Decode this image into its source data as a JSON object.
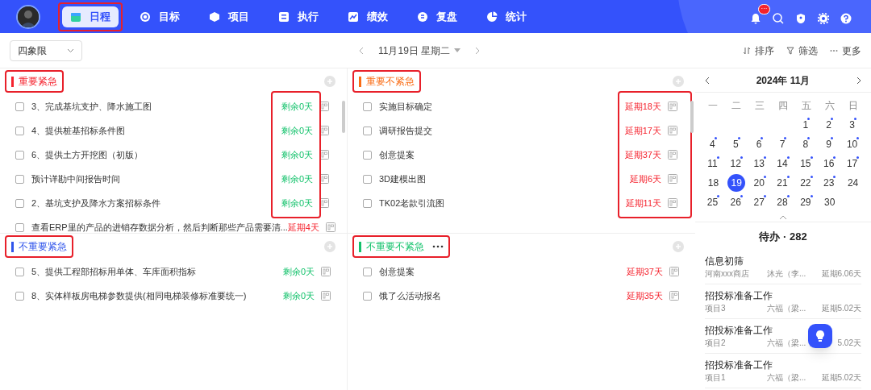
{
  "nav": {
    "items": [
      {
        "label": "日程",
        "selected": true,
        "highlighted": true
      },
      {
        "label": "目标",
        "selected": false,
        "highlighted": false
      },
      {
        "label": "项目",
        "selected": false,
        "highlighted": false
      },
      {
        "label": "执行",
        "selected": false,
        "highlighted": false
      },
      {
        "label": "绩效",
        "selected": false,
        "highlighted": false
      },
      {
        "label": "复盘",
        "selected": false,
        "highlighted": false
      },
      {
        "label": "统计",
        "selected": false,
        "highlighted": false
      }
    ],
    "notification_badge": "···"
  },
  "toolbar": {
    "view_select": "四象限",
    "date": "11月19日 星期二",
    "actions": [
      "排序",
      "筛选",
      "更多"
    ]
  },
  "quadrants": [
    {
      "title": "重要紧急",
      "color": "#f5222d",
      "highlighted": true,
      "more": false,
      "tasks": [
        {
          "title": "3、完成基坑支护、降水施工图",
          "due": "剩余0天",
          "overdue": false,
          "checked": false,
          "framed": true
        },
        {
          "title": "4、提供桩基招标条件图",
          "due": "剩余0天",
          "overdue": false,
          "checked": false,
          "framed": true
        },
        {
          "title": "6、提供土方开挖图（初版）",
          "due": "剩余0天",
          "overdue": false,
          "checked": false,
          "framed": true
        },
        {
          "title": "预计详勘中间报告时间",
          "due": "剩余0天",
          "overdue": false,
          "checked": false,
          "framed": true
        },
        {
          "title": "2、基坑支护及降水方案招标条件",
          "due": "剩余0天",
          "overdue": false,
          "checked": false,
          "framed": true
        },
        {
          "title": "查看ERP里的产品的进销存数据分析，然后判断那些产品需要清...",
          "due": "延期4天",
          "overdue": true,
          "checked": false,
          "framed": false
        }
      ]
    },
    {
      "title": "重要不紧急",
      "color": "#fa6c14",
      "highlighted": true,
      "more": false,
      "tasks": [
        {
          "title": "实施目标确定",
          "due": "延期18天",
          "overdue": true,
          "checked": false,
          "framed": true
        },
        {
          "title": "调研报告提交",
          "due": "延期17天",
          "overdue": true,
          "checked": false,
          "framed": true
        },
        {
          "title": "创意提案",
          "due": "延期37天",
          "overdue": true,
          "checked": false,
          "framed": true
        },
        {
          "title": "3D建模出图",
          "due": "延期6天",
          "overdue": true,
          "checked": false,
          "framed": true
        },
        {
          "title": "TK02老款引流图",
          "due": "延期11天",
          "overdue": true,
          "checked": false,
          "framed": true
        }
      ]
    },
    {
      "title": "不重要紧急",
      "color": "#2f54eb",
      "highlighted": true,
      "more": false,
      "tasks": [
        {
          "title": "5、提供工程部招标用单体、车库面积指标",
          "due": "剩余0天",
          "overdue": false,
          "checked": false
        },
        {
          "title": "8、实体样板房电梯参数提供(相同电梯装修标准要统一)",
          "due": "剩余0天",
          "overdue": false,
          "checked": false
        }
      ]
    },
    {
      "title": "不重要不紧急",
      "color": "#13c26b",
      "highlighted": true,
      "more": true,
      "tasks": [
        {
          "title": "创意提案",
          "due": "延期37天",
          "overdue": true,
          "checked": false
        },
        {
          "title": "饿了么活动报名",
          "due": "延期35天",
          "overdue": true,
          "checked": false
        }
      ]
    }
  ],
  "calendar": {
    "title": "2024年 11月",
    "weekdays": [
      "一",
      "二",
      "三",
      "四",
      "五",
      "六",
      "日"
    ],
    "days": [
      {
        "day": "1",
        "dot": true,
        "selected": false
      },
      {
        "day": "2",
        "dot": true,
        "selected": false
      },
      {
        "day": "3",
        "dot": true,
        "selected": false
      },
      {
        "day": "4",
        "dot": true,
        "selected": false
      },
      {
        "day": "5",
        "dot": true,
        "selected": false
      },
      {
        "day": "6",
        "dot": true,
        "selected": false
      },
      {
        "day": "7",
        "dot": true,
        "selected": false
      },
      {
        "day": "8",
        "dot": true,
        "selected": false
      },
      {
        "day": "9",
        "dot": true,
        "selected": false
      },
      {
        "day": "10",
        "dot": true,
        "selected": false
      },
      {
        "day": "11",
        "dot": true,
        "selected": false
      },
      {
        "day": "12",
        "dot": true,
        "selected": false
      },
      {
        "day": "13",
        "dot": true,
        "selected": false
      },
      {
        "day": "14",
        "dot": true,
        "selected": false
      },
      {
        "day": "15",
        "dot": true,
        "selected": false
      },
      {
        "day": "16",
        "dot": true,
        "selected": false
      },
      {
        "day": "17",
        "dot": true,
        "selected": false
      },
      {
        "day": "18",
        "dot": false,
        "selected": false
      },
      {
        "day": "19",
        "dot": false,
        "selected": true
      },
      {
        "day": "20",
        "dot": true,
        "selected": false
      },
      {
        "day": "21",
        "dot": true,
        "selected": false
      },
      {
        "day": "22",
        "dot": true,
        "selected": false
      },
      {
        "day": "23",
        "dot": true,
        "selected": false
      },
      {
        "day": "24",
        "dot": false,
        "selected": false
      },
      {
        "day": "25",
        "dot": true,
        "selected": false
      },
      {
        "day": "26",
        "dot": true,
        "selected": false
      },
      {
        "day": "27",
        "dot": true,
        "selected": false
      },
      {
        "day": "28",
        "dot": true,
        "selected": false
      },
      {
        "day": "29",
        "dot": true,
        "selected": false
      },
      {
        "day": "30",
        "dot": false,
        "selected": false
      }
    ]
  },
  "todo": {
    "title": "待办 · 282",
    "items": [
      {
        "title": "信息初筛",
        "project": "河南xxx商店",
        "owner": "沐光（李...",
        "due": "延期6.06天"
      },
      {
        "title": "招投标准备工作",
        "project": "项目3",
        "owner": "六福（梁...",
        "due": "延期5.02天"
      },
      {
        "title": "招投标准备工作",
        "project": "项目2",
        "owner": "六福（梁...",
        "due": "5.02天"
      },
      {
        "title": "招投标准备工作",
        "project": "项目1",
        "owner": "六福（梁...",
        "due": "延期5.02天"
      }
    ]
  }
}
